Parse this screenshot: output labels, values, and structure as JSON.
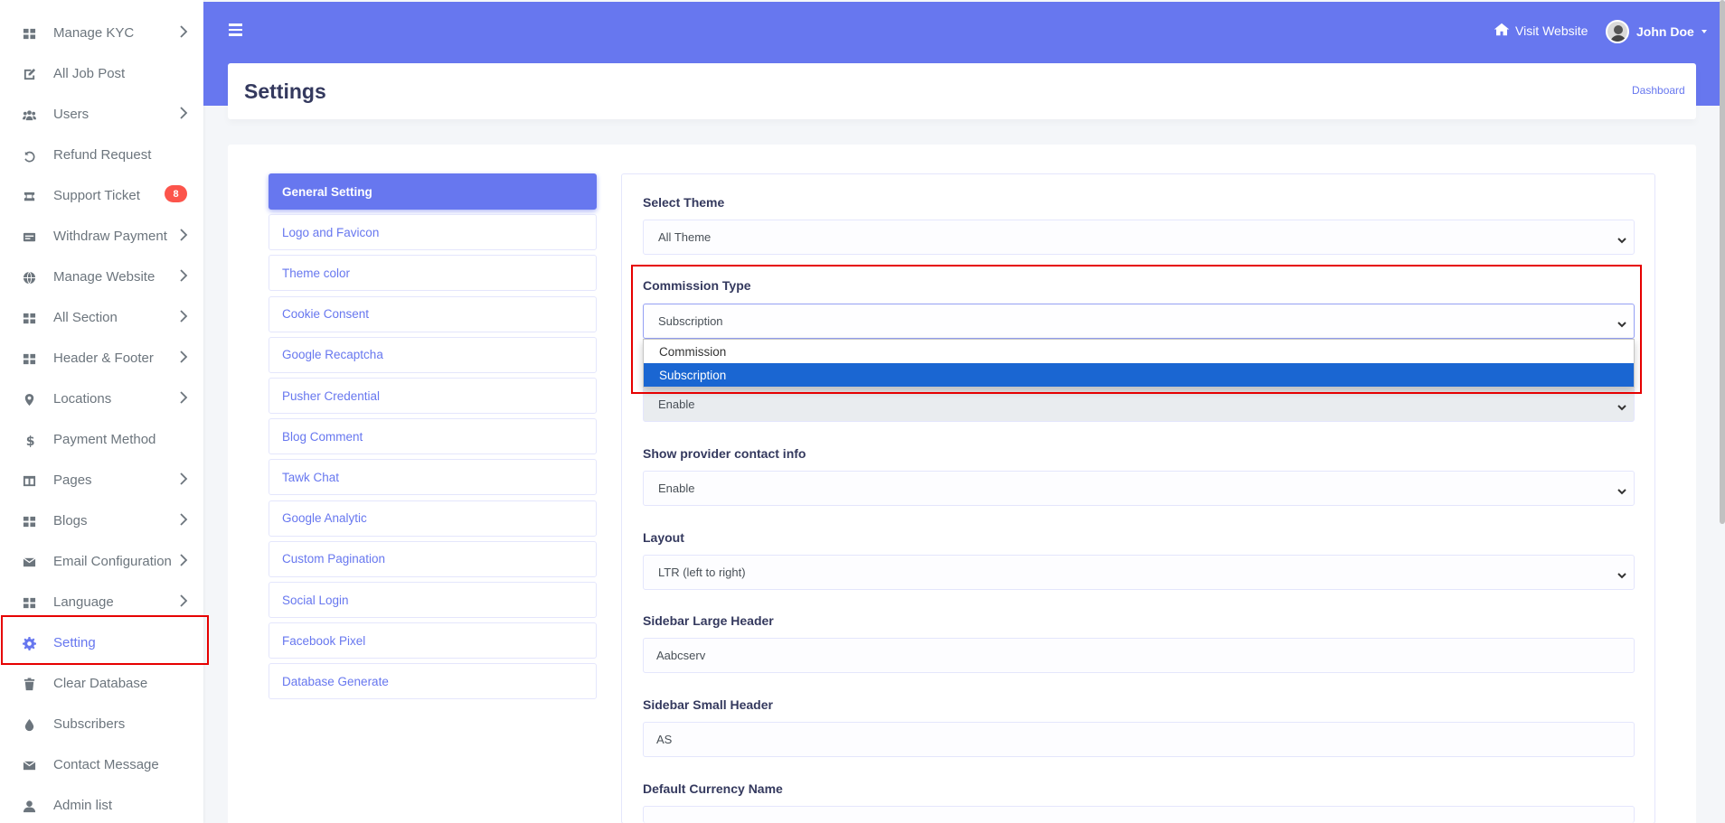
{
  "topbar": {
    "visit_label": "Visit Website",
    "user_name": "John Doe"
  },
  "sidebar": {
    "items": [
      {
        "label": "Manage KYC",
        "icon": "grid-icon",
        "chevron": true
      },
      {
        "label": "All Job Post",
        "icon": "edit-icon",
        "chevron": false
      },
      {
        "label": "Users",
        "icon": "users-icon",
        "chevron": true
      },
      {
        "label": "Refund Request",
        "icon": "undo-icon",
        "chevron": false
      },
      {
        "label": "Support Ticket",
        "icon": "ticket-icon",
        "chevron": false,
        "badge": "8"
      },
      {
        "label": "Withdraw Payment",
        "icon": "wallet-icon",
        "chevron": true
      },
      {
        "label": "Manage Website",
        "icon": "globe-icon",
        "chevron": true
      },
      {
        "label": "All Section",
        "icon": "grid-icon",
        "chevron": true
      },
      {
        "label": "Header & Footer",
        "icon": "grid-icon",
        "chevron": true
      },
      {
        "label": "Locations",
        "icon": "map-pin-icon",
        "chevron": true
      },
      {
        "label": "Payment Method",
        "icon": "dollar-icon",
        "chevron": false
      },
      {
        "label": "Pages",
        "icon": "columns-icon",
        "chevron": true
      },
      {
        "label": "Blogs",
        "icon": "grid-icon",
        "chevron": true
      },
      {
        "label": "Email Configuration",
        "icon": "envelope-icon",
        "chevron": true
      },
      {
        "label": "Language",
        "icon": "grid-icon",
        "chevron": true
      },
      {
        "label": "Setting",
        "icon": "gear-icon",
        "chevron": false,
        "active": true
      },
      {
        "label": "Clear Database",
        "icon": "trash-icon",
        "chevron": false
      },
      {
        "label": "Subscribers",
        "icon": "drop-icon",
        "chevron": false
      },
      {
        "label": "Contact Message",
        "icon": "envelope-icon",
        "chevron": false
      },
      {
        "label": "Admin list",
        "icon": "user-icon",
        "chevron": false
      }
    ]
  },
  "header": {
    "title": "Settings",
    "breadcrumb": "Dashboard"
  },
  "tabs": [
    "General Setting",
    "Logo and Favicon",
    "Theme color",
    "Cookie Consent",
    "Google Recaptcha",
    "Pusher Credential",
    "Blog Comment",
    "Tawk Chat",
    "Google Analytic",
    "Custom Pagination",
    "Social Login",
    "Facebook Pixel",
    "Database Generate"
  ],
  "form": {
    "select_theme": {
      "label": "Select Theme",
      "value": "All Theme"
    },
    "commission_type": {
      "label": "Commission Type",
      "value": "Subscription",
      "options": [
        "Commission",
        "Subscription"
      ],
      "selected": "Subscription"
    },
    "hidden_field": {
      "value": "Enable"
    },
    "show_provider_contact": {
      "label": "Show provider contact info",
      "value": "Enable"
    },
    "layout": {
      "label": "Layout",
      "value": "LTR (left to right)"
    },
    "sidebar_large_header": {
      "label": "Sidebar Large Header",
      "value": "Aabcserv"
    },
    "sidebar_small_header": {
      "label": "Sidebar Small Header",
      "value": "AS"
    },
    "default_currency_name": {
      "label": "Default Currency Name"
    }
  },
  "colors": {
    "primary": "#6777ef",
    "highlight": "#e60000",
    "badge": "#fc544b",
    "option_selected": "#1a66d2"
  }
}
